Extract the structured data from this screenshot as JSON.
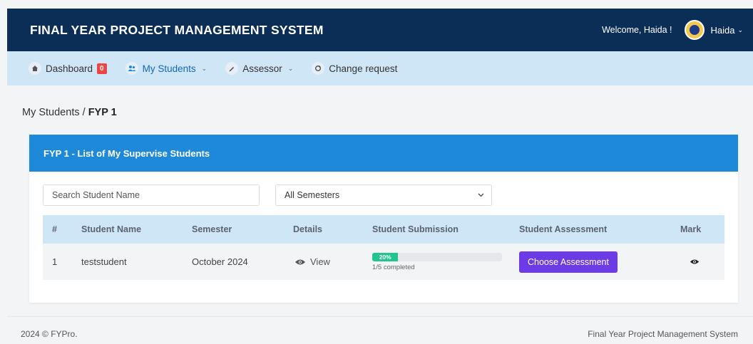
{
  "header": {
    "title": "FINAL YEAR PROJECT MANAGEMENT SYSTEM",
    "welcome": "Welcome, Haida !",
    "user_name": "Haida",
    "user_caret": "⌄"
  },
  "nav": {
    "dashboard": {
      "label": "Dashboard",
      "badge": "0",
      "icon": "home-icon"
    },
    "my_students": {
      "label": "My Students",
      "caret": "⌄",
      "icon": "users-icon"
    },
    "assessor": {
      "label": "Assessor",
      "caret": "⌄",
      "icon": "pencil-icon"
    },
    "change_request": {
      "label": "Change request",
      "icon": "refresh-icon"
    }
  },
  "breadcrumb": {
    "parent": "My Students",
    "separator": " / ",
    "current": "FYP 1"
  },
  "card": {
    "title": "FYP 1 - List of My Supervise Students"
  },
  "filters": {
    "search_placeholder": "Search Student Name",
    "semester_selected": "All Semesters"
  },
  "table": {
    "headers": [
      "#",
      "Student Name",
      "Semester",
      "Details",
      "Student Submission",
      "Student Assessment",
      "Mark"
    ],
    "rows": [
      {
        "num": "1",
        "name": "teststudent",
        "semester": "October 2024",
        "details": "View",
        "progress_label": "20%",
        "progress_value": 0.2,
        "progress_text": "1/5 completed",
        "assessment_button": "Choose Assessment"
      }
    ]
  },
  "footer": {
    "left": "2024 © FYPro.",
    "right": "Final Year Project Management System"
  },
  "colors": {
    "header_bg": "#0b2e57",
    "nav_bg": "#cfe6f7",
    "card_header_bg": "#1e88d9",
    "assess_button": "#6d3be6",
    "progress_fill": "#22c58e",
    "badge": "#ef4444"
  }
}
